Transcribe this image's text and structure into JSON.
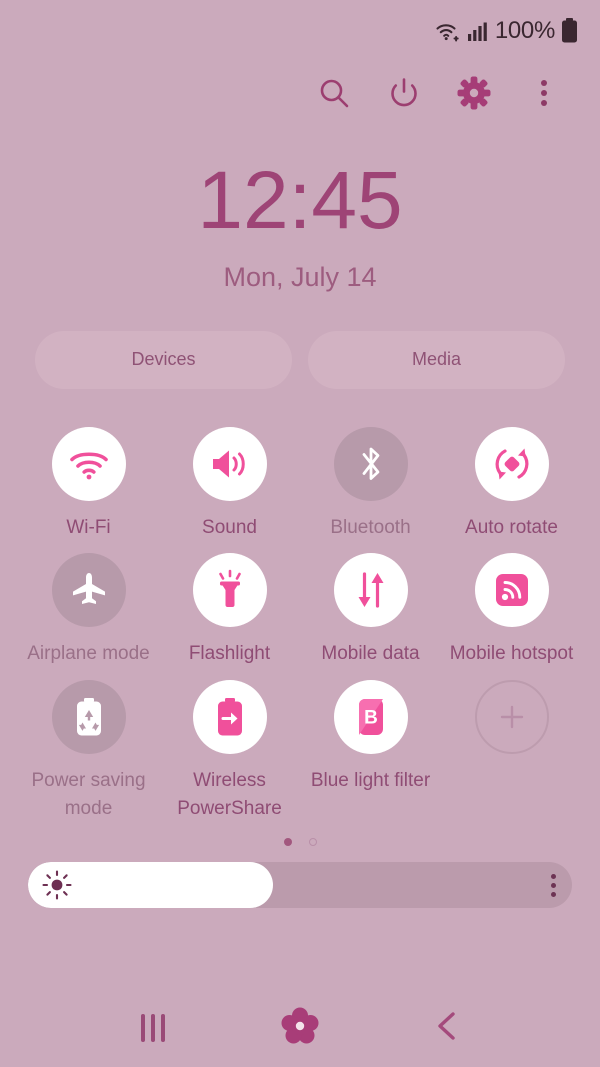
{
  "status_bar": {
    "wifi_icon": "wifi-signal-icon",
    "cellular_icon": "cellular-signal-icon",
    "battery_text": "100%",
    "battery_icon": "battery-full-icon"
  },
  "header": {
    "buttons": [
      {
        "name": "search-button",
        "icon": "search-icon"
      },
      {
        "name": "power-button",
        "icon": "power-icon"
      },
      {
        "name": "settings-button",
        "icon": "gear-icon"
      },
      {
        "name": "more-options-button",
        "icon": "overflow-menu-icon"
      }
    ]
  },
  "clock": {
    "time": "12:45",
    "date": "Mon, July 14"
  },
  "pills": [
    {
      "label": "Devices"
    },
    {
      "label": "Media"
    }
  ],
  "tiles": [
    {
      "label": "Wi-Fi",
      "icon": "wifi-icon",
      "state": "on"
    },
    {
      "label": "Sound",
      "icon": "sound-icon",
      "state": "on"
    },
    {
      "label": "Bluetooth",
      "icon": "bluetooth-icon",
      "state": "off"
    },
    {
      "label": "Auto rotate",
      "icon": "auto-rotate-icon",
      "state": "on"
    },
    {
      "label": "Airplane mode",
      "icon": "airplane-icon",
      "state": "off"
    },
    {
      "label": "Flashlight",
      "icon": "flashlight-icon",
      "state": "on"
    },
    {
      "label": "Mobile data",
      "icon": "mobile-data-icon",
      "state": "on"
    },
    {
      "label": "Mobile hotspot",
      "icon": "hotspot-icon",
      "state": "on"
    },
    {
      "label": "Power saving mode",
      "icon": "power-saving-icon",
      "state": "off"
    },
    {
      "label": "Wireless PowerShare",
      "icon": "wireless-powershare-icon",
      "state": "on"
    },
    {
      "label": "Blue light filter",
      "icon": "blue-light-filter-icon",
      "state": "on"
    },
    {
      "label": "",
      "icon": "add-icon",
      "state": "add"
    }
  ],
  "pager": {
    "pages": 2,
    "active": 1
  },
  "brightness": {
    "icon": "brightness-sun-icon",
    "value_percent": 45,
    "menu_icon": "overflow-menu-icon"
  },
  "nav_bar": {
    "recents": {
      "label": "Recents",
      "icon": "recents-icon"
    },
    "home": {
      "label": "Home",
      "icon": "home-flower-icon"
    },
    "back": {
      "label": "Back",
      "icon": "back-chevron-icon"
    }
  },
  "colors": {
    "background": "#cbaabc",
    "accent_pink": "#f0509b",
    "text_primary": "#8f4c74",
    "toggle_on_bg": "#ffffff",
    "toggle_off_bg": "#b79aaa"
  }
}
